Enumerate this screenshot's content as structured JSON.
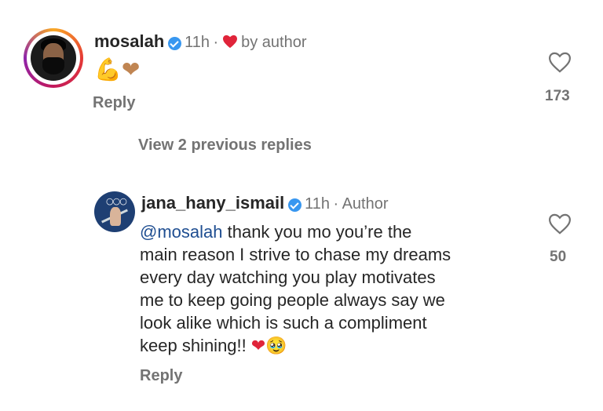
{
  "comment": {
    "username": "mosalah",
    "time": "11h",
    "separator": "·",
    "liked_by": "by author",
    "text": "💪❤",
    "reply_label": "Reply",
    "likes": "173"
  },
  "view_previous": "View 2 previous replies",
  "reply": {
    "username": "jana_hany_ismail",
    "time": "11h",
    "separator": "·",
    "author_badge": "Author",
    "mention": "@mosalah",
    "lines": [
      " thank you mo you’re the",
      "main reason I strive to chase my dreams",
      "every day watching you play motivates",
      "me to keep going people always say we",
      "look alike which is such a compliment",
      "keep shining!!"
    ],
    "trailing_emoji": "❤🥹",
    "reply_label": "Reply",
    "likes": "50"
  },
  "colors": {
    "heart": "#e0243a",
    "verified": "#3897f0",
    "mention": "#1f4e91",
    "meta": "#737373"
  },
  "icons": [
    "verified-icon",
    "heart-icon",
    "like-outline-icon"
  ]
}
